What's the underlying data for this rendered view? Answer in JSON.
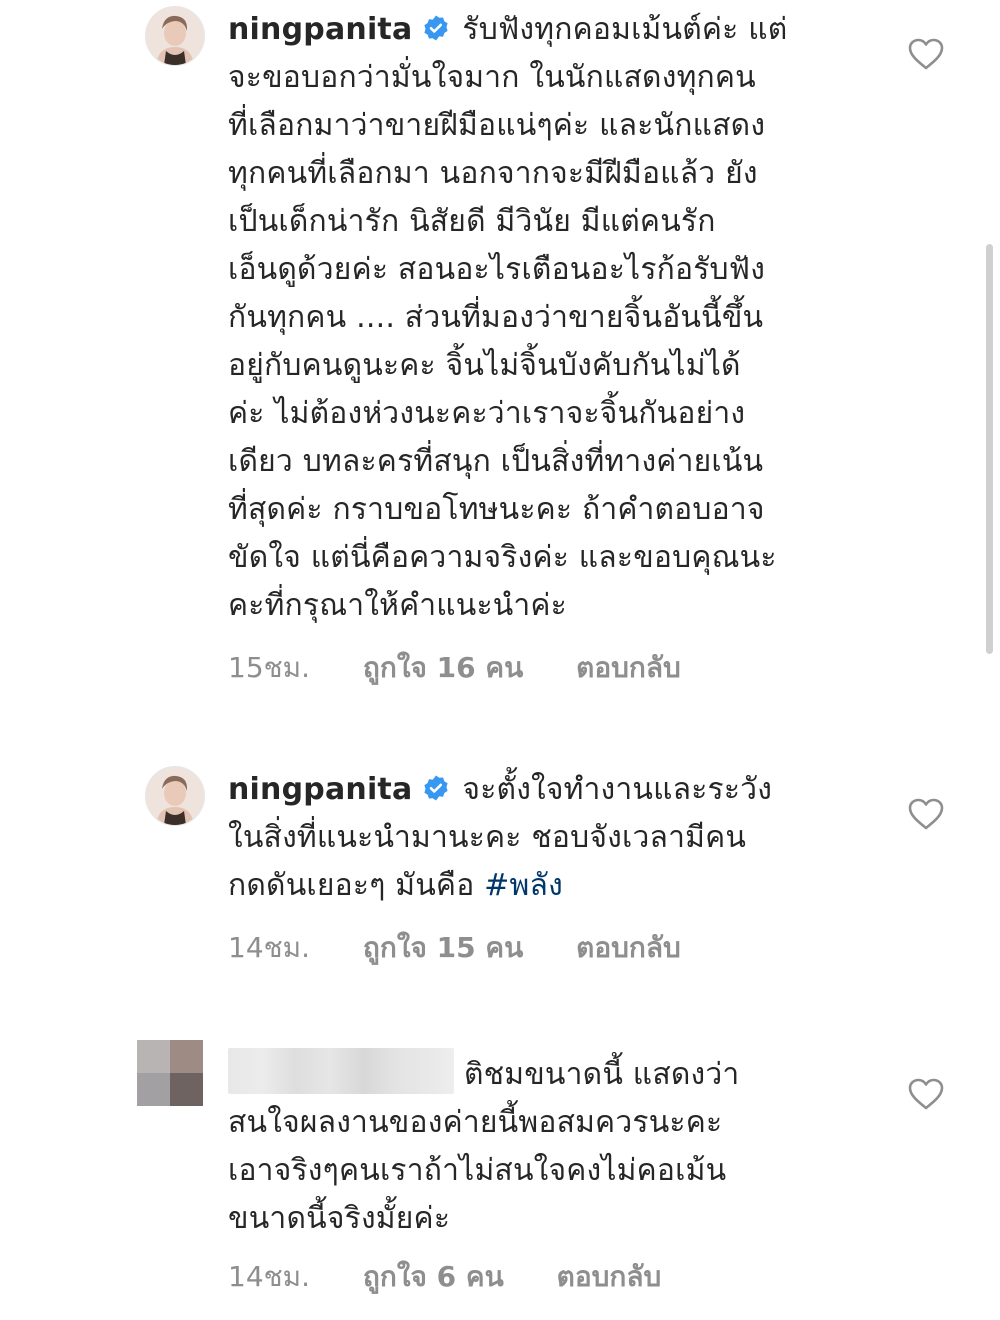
{
  "comments": [
    {
      "username": "ningpanita",
      "verified": true,
      "lines": [
        "รับฟังทุกคอมเม้นต์ค่ะ แต่",
        "จะขอบอกว่ามั่นใจมาก ในนักแสดงทุกคน",
        "ที่เลือกมาว่าขายฝีมือแน่ๆค่ะ และนักแสดง",
        "ทุกคนที่เลือกมา นอกจากจะมีฝีมือแล้ว ยัง",
        "เป็นเด็กน่ารัก นิสัยดี มีวินัย มีแต่คนรัก",
        "เอ็นดูด้วยค่ะ สอนอะไรเตือนอะไรก้อรับฟัง",
        "กันทุกคน .... ส่วนที่มองว่าขายจิ้นอันนี้ขึ้น",
        "อยู่กับคนดูนะคะ จิ้นไม่จิ้นบังคับกันไม่ได้",
        "ค่ะ ไม่ต้องห่วงนะคะว่าเราจะจิ้นกันอย่าง",
        "เดียว บทละครที่สนุก เป็นสิ่งที่ทางค่ายเน้น",
        "ที่สุดค่ะ กราบขอโทษนะคะ ถ้าคำตอบอาจ",
        "ขัดใจ แต่นี่คือความจริงค่ะ และขอบคุณนะ",
        "คะที่กรุณาให้คำแนะนำค่ะ"
      ],
      "time": "15ชม.",
      "likes": "ถูกใจ 16 คน",
      "reply": "ตอบกลับ"
    },
    {
      "username": "ningpanita",
      "verified": true,
      "lines": [
        "จะตั้งใจทำงานและระวัง",
        "ในสิ่งที่แนะนำมานะคะ ชอบจังเวลามีคน",
        "กดดันเยอะๆ มันคือ"
      ],
      "hashtag": "#พลัง",
      "time": "14ชม.",
      "likes": "ถูกใจ 15 คน",
      "reply": "ตอบกลับ"
    },
    {
      "username": "",
      "verified": false,
      "lines": [
        "ติชมขนาดนี้ แสดงว่า",
        "สนใจผลงานของค่ายนี้พอสมควรนะคะ",
        "เอาจริงๆคนเราถ้าไม่สนใจคงไม่คอเม้น",
        "ขนาดนี้จริงมั้ยค่ะ"
      ],
      "time": "14ชม.",
      "likes": "ถูกใจ 6 คน",
      "reply": "ตอบกลับ"
    }
  ],
  "icons": {
    "verified": "verified-badge-icon",
    "like": "heart-outline-icon"
  },
  "colors": {
    "text": "#262626",
    "meta": "#8e8e8e",
    "hashtag": "#00376b",
    "verified": "#3897f0"
  }
}
